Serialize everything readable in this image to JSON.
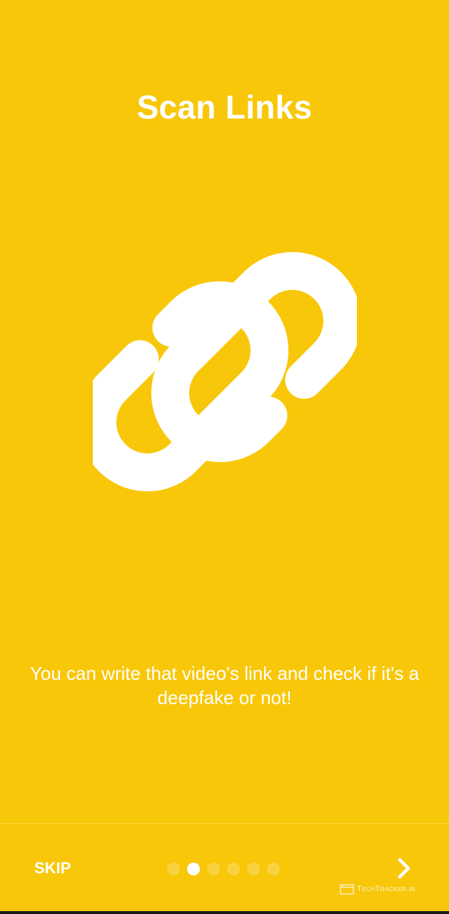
{
  "onboarding": {
    "title": "Scan Links",
    "icon": "link-icon",
    "description": "You can write that video's link and check if it's a deepfake or not!",
    "background_color": "#F8C70A"
  },
  "navigation": {
    "skip_label": "SKIP",
    "next_icon": "chevron-right-icon",
    "page_count": 6,
    "current_page": 2
  },
  "watermark": {
    "text": "TechTracker.in"
  }
}
